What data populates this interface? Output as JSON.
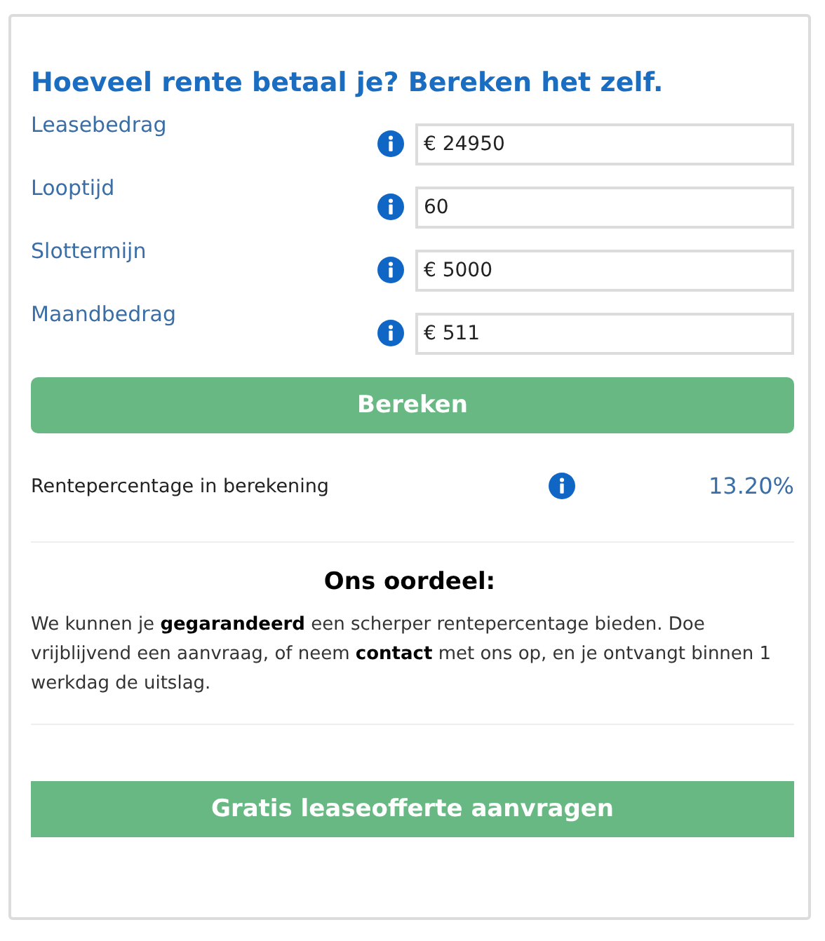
{
  "title": "Hoeveel rente betaal je? Bereken het zelf.",
  "fields": [
    {
      "label": "Leasebedrag",
      "value": "€ 24950"
    },
    {
      "label": "Looptijd",
      "value": "60"
    },
    {
      "label": "Slottermijn",
      "value": "€ 5000"
    },
    {
      "label": "Maandbedrag",
      "value": "€ 511"
    }
  ],
  "calculate_button": "Bereken",
  "result": {
    "label": "Rentepercentage in berekening",
    "value": "13.20%"
  },
  "verdict": {
    "heading": "Ons oordeel:",
    "text": "We kunnen je **gegarandeerd** een scherper rentepercentage bieden. Doe vrijblijvend een aanvraag, of neem **contact** met ons op, en je ontvangt binnen 1 werkdag de uitslag."
  },
  "quote_button": "Gratis leaseofferte aanvragen"
}
